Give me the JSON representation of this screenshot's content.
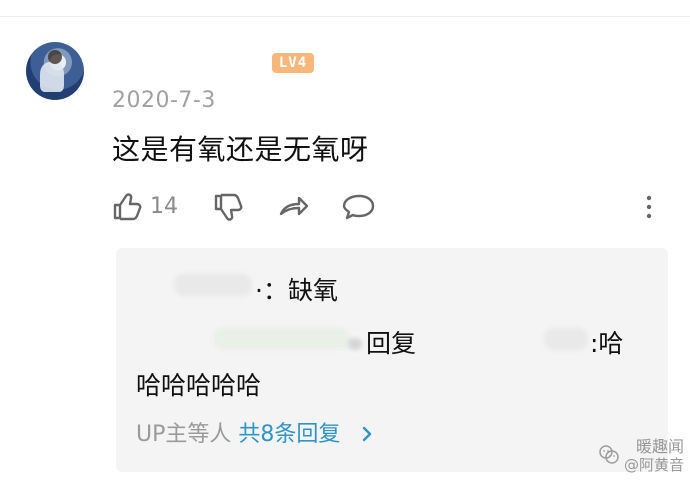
{
  "comment": {
    "level_badge": "LV4",
    "date": "2020-7-3",
    "text": "这是有氧还是无氧呀",
    "like_count": "14"
  },
  "reply_box": {
    "line1": "·：缺氧",
    "line2": "回复",
    "line2_suffix": ":哈",
    "line3": "哈哈哈哈哈",
    "summary_prefix": "UP主等人 ",
    "summary_count": "共8条回复",
    "arrow": "›"
  },
  "watermark": {
    "top": "暖趣闻",
    "bottom": "@阿黄音"
  },
  "icons": {
    "like": "thumbs-up-icon",
    "dislike": "thumbs-down-icon",
    "share": "share-icon",
    "comment": "comment-icon",
    "more": "more-icon",
    "arrow": "chevron-right-icon"
  },
  "colors": {
    "badge": "#f7b77a",
    "reply_link": "#2f95c7",
    "muted": "#9a9a9a"
  }
}
